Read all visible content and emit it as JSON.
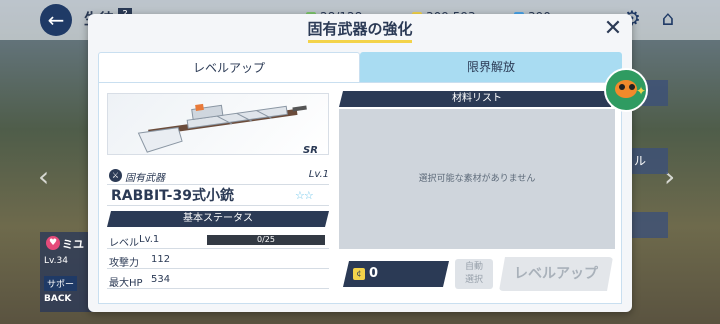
{
  "background": {
    "title": "生徒",
    "help_label": "?",
    "resources": [
      {
        "icon": "ap-icon",
        "value": "28/128",
        "color": "#7cc56b"
      },
      {
        "icon": "credit-icon",
        "value": "309,593",
        "color": "#f3d34a"
      },
      {
        "icon": "pyroxene-icon",
        "value": "390",
        "color": "#4aa3e8"
      }
    ],
    "left_card": {
      "name": "ミユ",
      "level": "Lv.34",
      "support": "サポー",
      "back": "BACK"
    },
    "right_text": "ル"
  },
  "modal": {
    "title": "固有武器の強化",
    "tabs": [
      {
        "label": "レベルアップ",
        "active": true
      },
      {
        "label": "限界解放",
        "active": false
      }
    ],
    "weapon": {
      "rarity": "SR",
      "type": "固有武器",
      "level": "Lv.1",
      "name": "RABBIT-39式小銃",
      "stars": "☆☆",
      "status_header": "基本ステータス",
      "stats": [
        {
          "label": "レベル",
          "value": "Lv.1",
          "xp": "0/25",
          "xp_fraction": 0
        },
        {
          "label": "攻撃力",
          "value": "112"
        },
        {
          "label": "最大HP",
          "value": "534"
        }
      ]
    },
    "materials": {
      "header": "材料リスト",
      "empty_message": "選択可能な素材がありません"
    },
    "footer": {
      "credit_value": "0",
      "auto_label_line1": "自動",
      "auto_label_line2": "選択",
      "levelup_label": "レベルアップ"
    }
  },
  "colors": {
    "navy": "#2b3a55",
    "tab_inactive": "#a9dcf2",
    "accent_yellow": "#f3d34a",
    "star_blue": "#6fc6ea"
  }
}
